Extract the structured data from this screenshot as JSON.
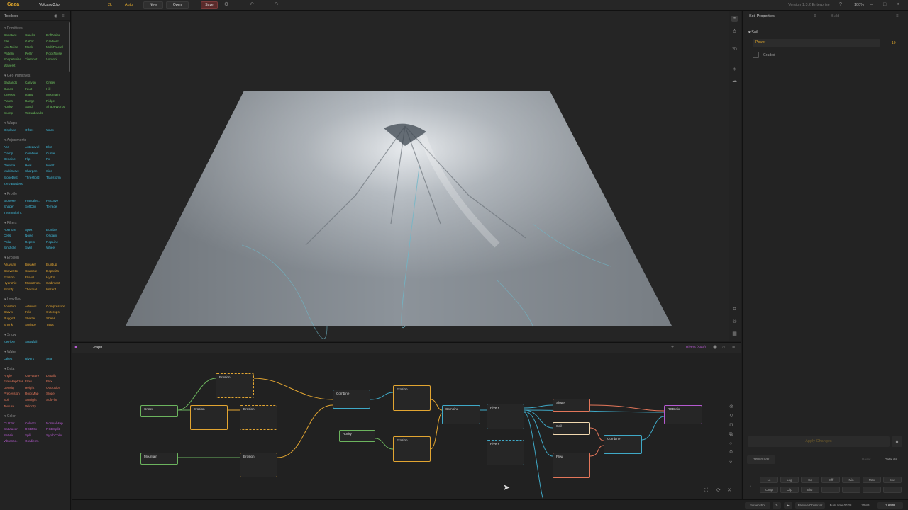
{
  "topbar": {
    "logo": "Gaea",
    "file": "Volcano3.tor",
    "res": "2k",
    "build": "Auto",
    "new": "New",
    "open": "Open",
    "save": "Save",
    "version": "Version 1.3.2 Enterprise",
    "zoom": "100%"
  },
  "toolbox": {
    "title": "Toolbox",
    "categories": [
      {
        "name": "Primitives",
        "color": "#6cbf5e",
        "items": [
          "Constant",
          "Cracks",
          "DriftNoise",
          "File",
          "Gabor",
          "Gradient",
          "LineNoise",
          "Mask",
          "MultiFractal",
          "Pattern",
          "Perlin",
          "RockNoise",
          "ShapeNoise",
          "TileInput",
          "Voronoi",
          "Wavelet"
        ]
      },
      {
        "name": "Geo Primitives",
        "color": "#6cbf5e",
        "items": [
          "Badlands",
          "Canyon",
          "Crater",
          "Dunes",
          "Fault",
          "Hill",
          "Igneous",
          "Island",
          "Mountain",
          "Plates",
          "Range",
          "Ridge",
          "Rocky",
          "Sand",
          "ShapeWorks",
          "Slump",
          "Wizardlands"
        ]
      },
      {
        "name": "Warps",
        "color": "#3fb9d9",
        "items": [
          "Displace",
          "Offset",
          "Warp"
        ]
      },
      {
        "name": "Adjustments",
        "color": "#3fb9d9",
        "items": [
          "Abs",
          "AutoLevel",
          "Blur",
          "Clamp",
          "Combine",
          "Curve",
          "Denoise",
          "Flip",
          "Fx",
          "Gamma",
          "Heal",
          "Invert",
          "MultiCurve",
          "Sharpen",
          "Size",
          "SlopeDist",
          "Threshold",
          "Transform",
          "Zero Borders"
        ]
      },
      {
        "name": "Profile",
        "color": "#3fb9d9",
        "items": [
          "Blobeser",
          "FractalTe..",
          "Recurve",
          "Shaper",
          "SoftClip",
          "Terrace",
          "Thermal Sh.."
        ]
      },
      {
        "name": "Filters",
        "color": "#3fb9d9",
        "items": [
          "Aperture",
          "Apex",
          "Bomber",
          "Cells",
          "Noise",
          "Origami",
          "Polar",
          "Repeat",
          "RepLine",
          "Sinkhole",
          "Swirl",
          "Wheel"
        ]
      },
      {
        "name": "Erosion",
        "color": "#e2a531",
        "items": [
          "Alluvium",
          "Breaker",
          "Buildup",
          "Convector",
          "Crumble",
          "Deposits",
          "Erosion",
          "Fluvial",
          "Hydro",
          "HydroFix",
          "MicroEros..",
          "Sediment",
          "Stratify",
          "Thermal",
          "Wizard"
        ]
      },
      {
        "name": "LookDev",
        "color": "#e2a531",
        "items": [
          "Anastom...",
          "Artisinal",
          "Compression",
          "Carver",
          "Fold",
          "Outcrops",
          "Rugged",
          "Shatter",
          "Shear",
          "Shrink",
          "Surface",
          "Talus"
        ]
      },
      {
        "name": "Snow",
        "color": "#3fb9d9",
        "items": [
          "IceFlow",
          "Snowfall"
        ]
      },
      {
        "name": "Water",
        "color": "#3fb9d9",
        "items": [
          "Lakes",
          "Rivers",
          "Sea"
        ]
      },
      {
        "name": "Data",
        "color": "#e3765a",
        "items": [
          "Angle",
          "Curvature",
          "Details",
          "FlowMapClas",
          "Flow",
          "Flux",
          "Density",
          "Height",
          "Occlusion",
          "Precession",
          "RockMap",
          "Slope",
          "Soil",
          "Sunlight",
          "SoftFlat",
          "Texture",
          "Velocity"
        ]
      },
      {
        "name": "Color",
        "color": "#b55ad0",
        "items": [
          "CLUTer",
          "ColorFx",
          "NormalMap",
          "SatMaker",
          "RGBMix",
          "RGBSplit",
          "SatMix",
          "Split",
          "SynthColor",
          "Vibrance..",
          "Gradient.."
        ]
      }
    ]
  },
  "graph": {
    "title": "Graph",
    "badge": "Rivers (Auto)",
    "nodes": [
      {
        "label": "Crater",
        "cls": "nprim"
      },
      {
        "label": "Erosion",
        "cls": "nerosolid"
      },
      {
        "label": "Erosion",
        "cls": "nero"
      },
      {
        "label": "Erosion",
        "cls": "nero"
      },
      {
        "label": "Mountain",
        "cls": "nprim"
      },
      {
        "label": "Erosion",
        "cls": "nerosolid"
      },
      {
        "label": "Combine",
        "cls": "ncomb"
      },
      {
        "label": "Erosion",
        "cls": "nerosolid"
      },
      {
        "label": "Rocky",
        "cls": "nprim"
      },
      {
        "label": "Erosion",
        "cls": "nerosolid"
      },
      {
        "label": "Combine",
        "cls": "ncomb"
      },
      {
        "label": "Rivers",
        "cls": "ncomb"
      },
      {
        "label": "Rivers",
        "cls": "nsel"
      },
      {
        "label": "Slope",
        "cls": "ndata"
      },
      {
        "label": "Soil",
        "cls": "ndata"
      },
      {
        "label": "Flow",
        "cls": "ndata"
      },
      {
        "label": "Combine",
        "cls": "ncomb"
      },
      {
        "label": "RGBMix",
        "cls": "nrgb"
      }
    ]
  },
  "props": {
    "tab1": "Soil Properties",
    "tab2": "Build",
    "section": "Soil",
    "power_label": "Power",
    "power_value": "10",
    "graded": "Graded",
    "apply": "Apply Changes",
    "remember": "Remember",
    "reset": "Reset",
    "defaults": "Defaults",
    "keys": [
      [
        "Lo",
        "Log",
        "Eq",
        "Diff",
        "Min",
        "Max",
        "Inv"
      ],
      [
        "Clmp",
        "Clip",
        "Blur",
        "",
        "",
        "",
        ""
      ]
    ]
  },
  "status": {
    "screenshot": "Screenshot",
    "passive": "Passive Optimizer",
    "buildtime": "Build time 00:28",
    "mem": "20MB",
    "value": "2.6308"
  },
  "colors": {
    "primitive": "#6cb45e",
    "erosion": "#e2a531",
    "adjust": "#3fa9c7",
    "data": "#e3765a",
    "color": "#b55ad0",
    "accent": "#e3a92b"
  }
}
